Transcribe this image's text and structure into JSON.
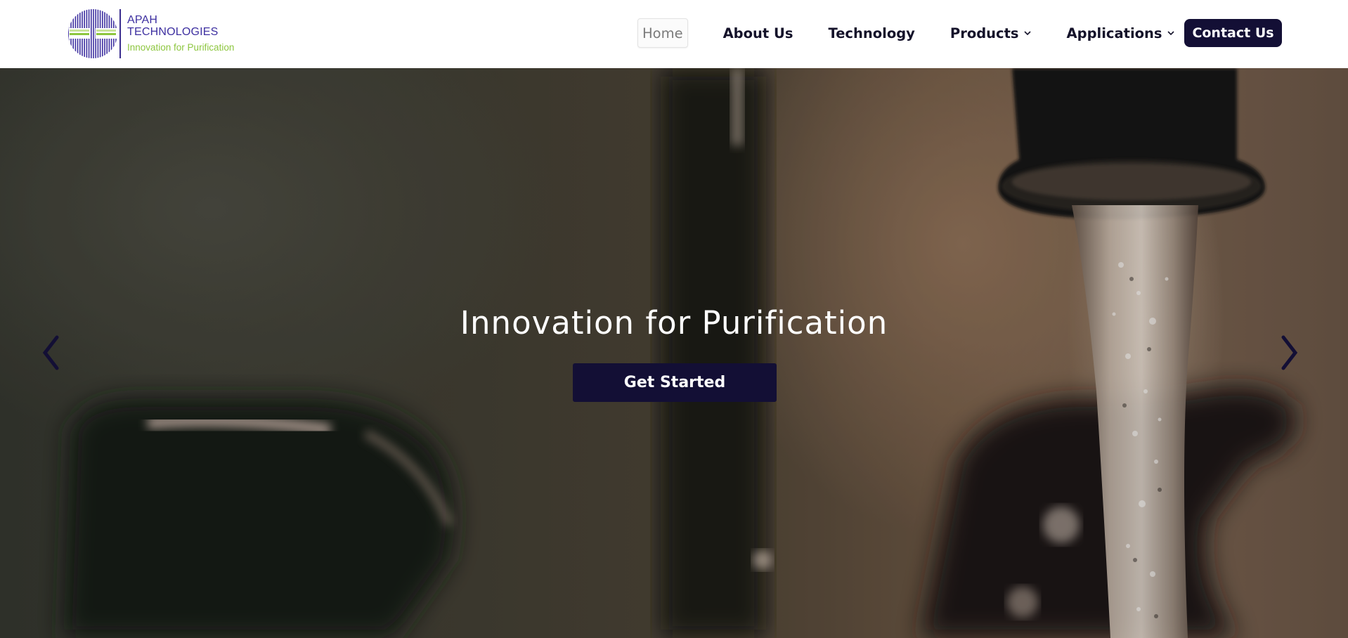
{
  "brand": {
    "name_line1": "APAH",
    "name_line2": "TECHNOLOGIES",
    "tagline": "Innovation for Purification",
    "logo_colors": {
      "stripes": "#3d2fa0",
      "accent": "#8dc63f"
    }
  },
  "nav": {
    "items": [
      {
        "label": "Home",
        "active": true,
        "has_dropdown": false
      },
      {
        "label": "About Us",
        "active": false,
        "has_dropdown": false
      },
      {
        "label": "Technology",
        "active": false,
        "has_dropdown": false
      },
      {
        "label": "Products",
        "active": false,
        "has_dropdown": true
      },
      {
        "label": "Applications",
        "active": false,
        "has_dropdown": true
      }
    ],
    "cta_label": "Contact Us"
  },
  "hero": {
    "title": "Innovation for Purification",
    "button_label": "Get Started",
    "prev_icon": "chevron-left-icon",
    "next_icon": "chevron-right-icon",
    "background": "water-faucet-photo"
  },
  "colors": {
    "primary": "#130f35",
    "nav_text": "#14122a",
    "active_nav_text": "#7a7a7a"
  }
}
